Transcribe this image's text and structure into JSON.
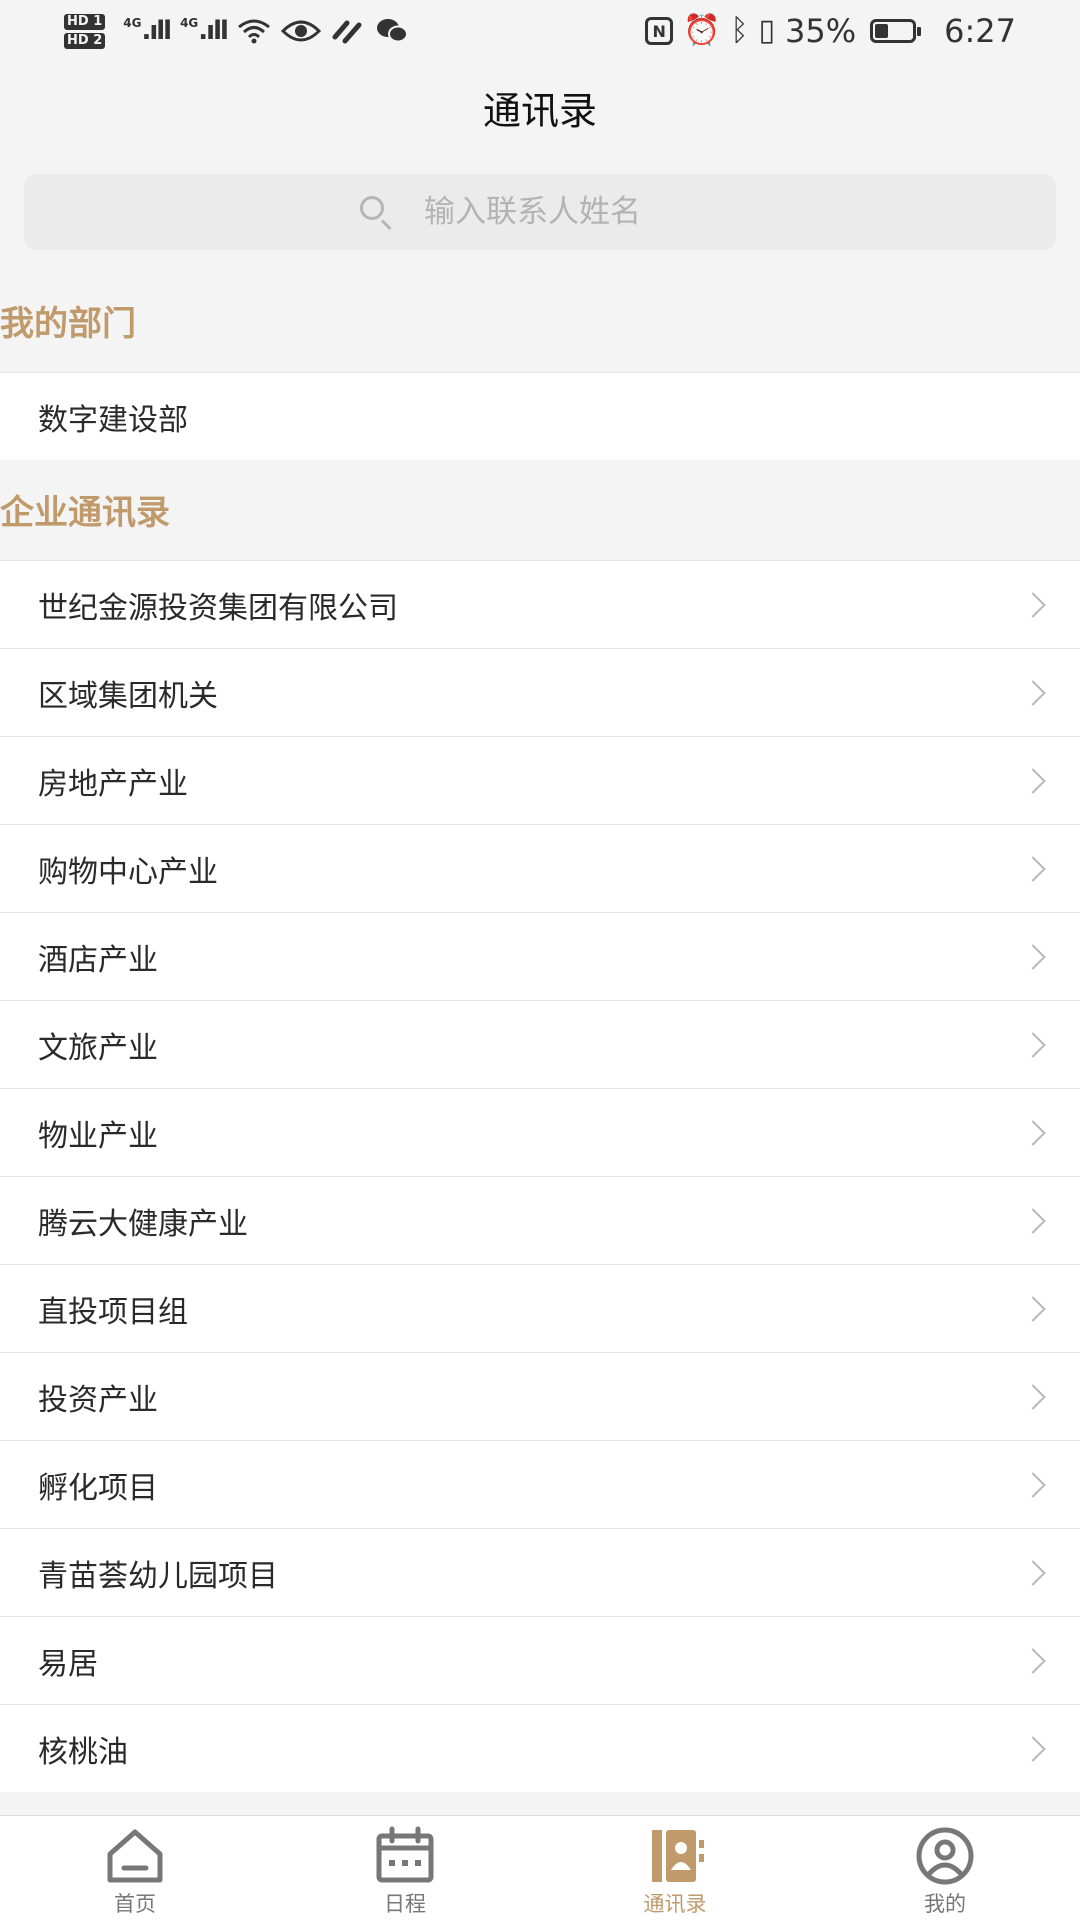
{
  "status_bar": {
    "hd1": "HD 1",
    "hd2": "HD 2",
    "signal1": "4G",
    "signal2": "4G",
    "battery_text": "35%",
    "time": "6:27",
    "icons": [
      "wifi-icon",
      "eye-icon",
      "link-icon",
      "wechat-icon",
      "nfc-icon",
      "alarm-icon",
      "bluetooth-icon",
      "vibrate-icon",
      "battery-icon"
    ]
  },
  "header": {
    "title": "通讯录"
  },
  "search": {
    "placeholder": "输入联系人姓名"
  },
  "my_department": {
    "title": "我的部门",
    "item": "数字建设部"
  },
  "enterprise_directory": {
    "title": "企业通讯录",
    "items": [
      "世纪金源投资集团有限公司",
      "区域集团机关",
      "房地产产业",
      "购物中心产业",
      "酒店产业",
      "文旅产业",
      "物业产业",
      "腾云大健康产业",
      "直投项目组",
      "投资产业",
      "孵化项目",
      "青苗荟幼儿园项目",
      "易居",
      "核桃油"
    ]
  },
  "tab_bar": {
    "active_color": "#c09a6b",
    "inactive_color": "#777777",
    "tabs": [
      {
        "label": "首页",
        "icon": "home-icon"
      },
      {
        "label": "日程",
        "icon": "calendar-icon"
      },
      {
        "label": "通讯录",
        "icon": "contacts-icon"
      },
      {
        "label": "我的",
        "icon": "profile-icon"
      }
    ]
  },
  "colors": {
    "accent": "#c09a6b",
    "background": "#f4f4f4",
    "row_background": "#ffffff"
  }
}
